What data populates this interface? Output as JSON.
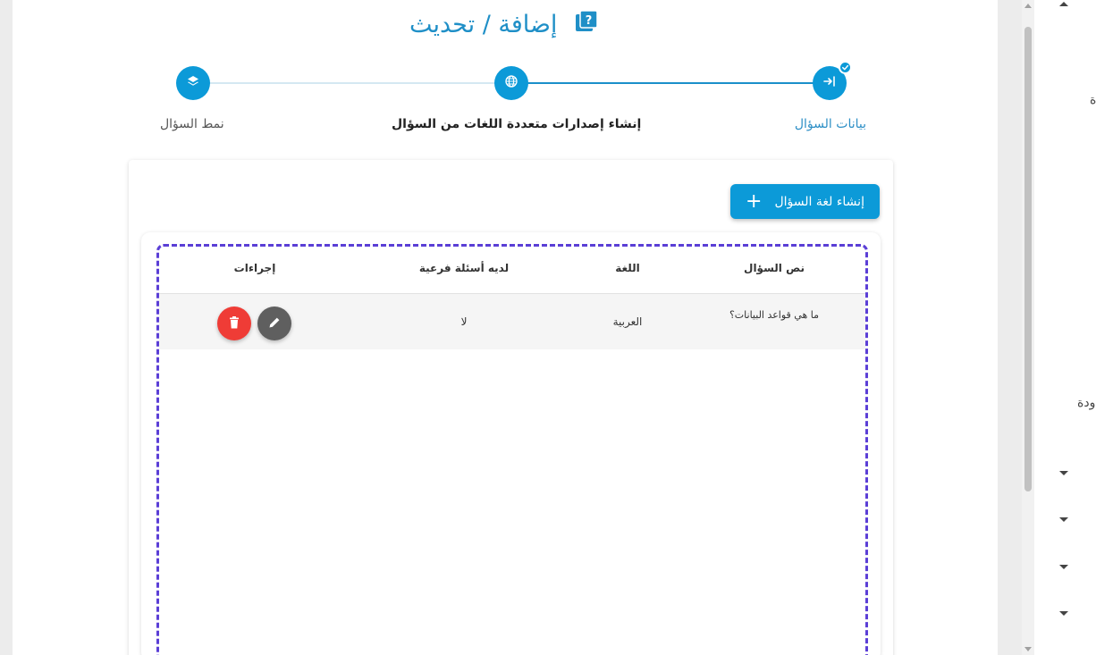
{
  "header": {
    "title": "إضافة / تحديث"
  },
  "stepper": {
    "steps": [
      {
        "label": "بيانات السؤال",
        "state": "completed"
      },
      {
        "label": "إنشاء إصدارات متعددة اللغات من السؤال",
        "state": "active"
      },
      {
        "label": "نمط السؤال",
        "state": "pending"
      }
    ]
  },
  "toolbar": {
    "add_language_label": "إنشاء لغة السؤال"
  },
  "table": {
    "columns": [
      "نص السؤال",
      "اللغة",
      "لديه أسئلة فرعية",
      "إجراءات"
    ],
    "rows": [
      {
        "question_text": "ما هي قواعد البيانات؟",
        "language": "العربية",
        "has_sub_questions": "لا"
      }
    ]
  },
  "side_panel": {
    "fragment_1": "ة",
    "fragment_2": "ودة"
  },
  "colors": {
    "primary": "#0c9ad8",
    "title": "#1f8fc7",
    "delete": "#ef3c36",
    "edit": "#5f5f5f",
    "dashed_frame": "#5b3fd6"
  },
  "icons": [
    "question-book-icon",
    "sign-in-icon",
    "check-icon",
    "globe-icon",
    "layers-icon",
    "plus-icon",
    "trash-icon",
    "pencil-icon",
    "caret-up-icon",
    "caret-down-icon"
  ]
}
